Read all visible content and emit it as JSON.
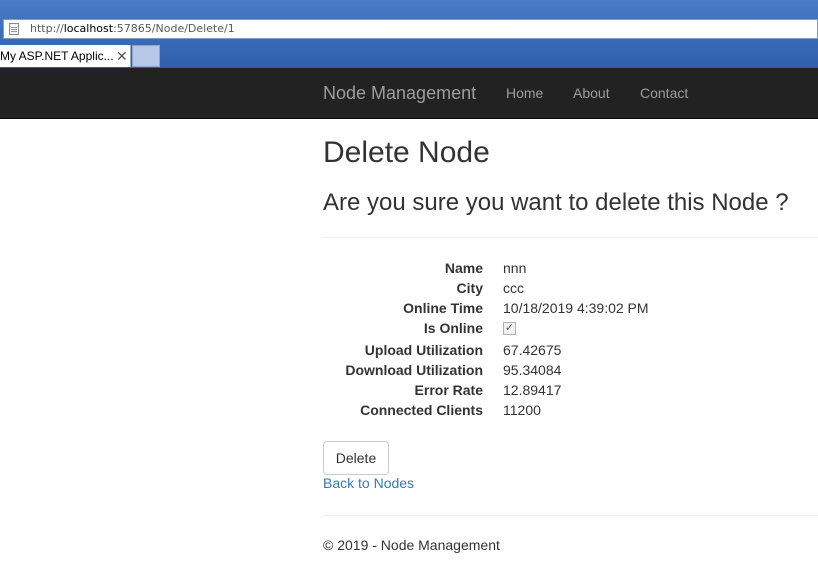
{
  "browser": {
    "url_prefix": "http://",
    "url_host": "localhost",
    "url_rest": ":57865/Node/Delete/1",
    "tab_title": "My ASP.NET Applic...",
    "tab_close": "✕"
  },
  "navbar": {
    "brand": "Node Management",
    "links": [
      "Home",
      "About",
      "Contact"
    ]
  },
  "page": {
    "heading": "Delete Node",
    "question": "Are you sure you want to delete this Node ?"
  },
  "details": {
    "name_label": "Name",
    "name_value": "nnn",
    "city_label": "City",
    "city_value": "ccc",
    "online_time_label": "Online Time",
    "online_time_value": "10/18/2019 4:39:02 PM",
    "is_online_label": "Is Online",
    "is_online_checked": true,
    "upload_label": "Upload Utilization",
    "upload_value": "67.42675",
    "download_label": "Download Utilization",
    "download_value": "95.34084",
    "error_rate_label": "Error Rate",
    "error_rate_value": "12.89417",
    "clients_label": "Connected Clients",
    "clients_value": "11200"
  },
  "actions": {
    "delete_label": "Delete",
    "back_label": "Back to Nodes"
  },
  "footer": {
    "text": "© 2019 - Node Management"
  },
  "colors": {
    "navbar_bg": "#222222",
    "nav_text": "#9d9d9d",
    "link": "#337ab7",
    "chrome_blue": "#2e5eac"
  }
}
